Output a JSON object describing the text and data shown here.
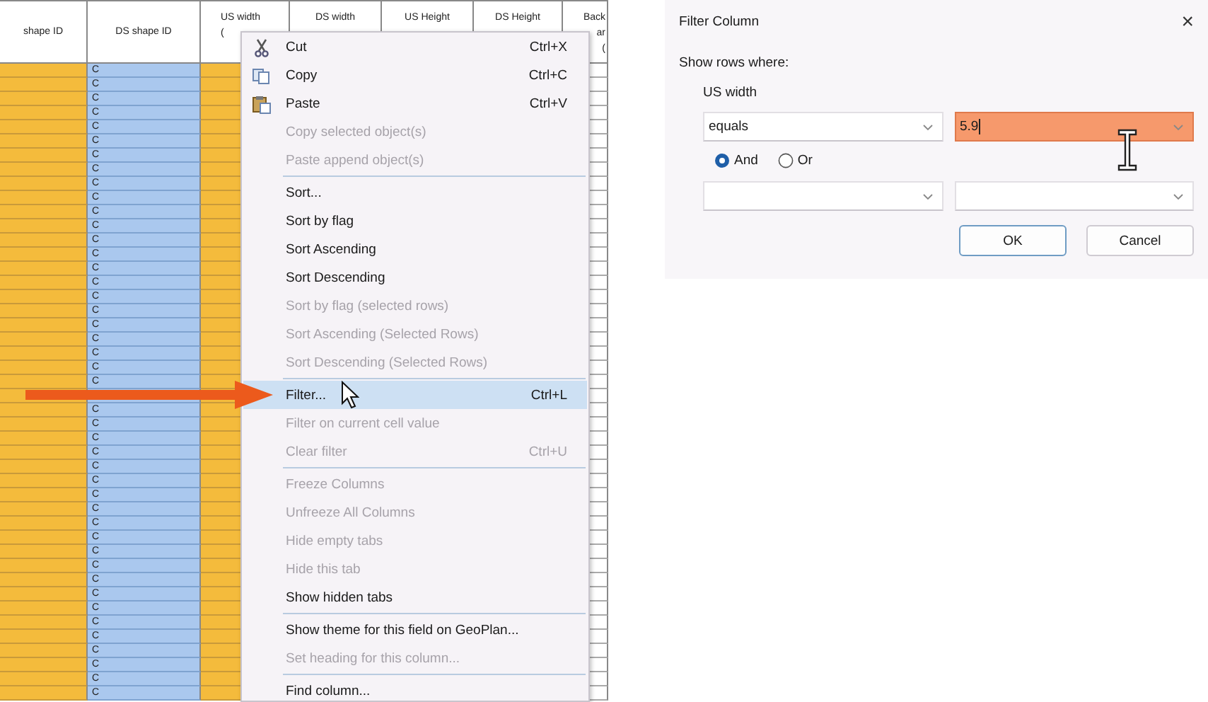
{
  "table": {
    "columns": [
      {
        "lines": [
          "shape ID"
        ],
        "kind": "key"
      },
      {
        "lines": [
          "DS shape ID"
        ],
        "kind": "link"
      },
      {
        "lines": [
          "US width",
          "("
        ],
        "kind": "key"
      },
      {
        "lines": [
          "DS width"
        ],
        "kind": "plain"
      },
      {
        "lines": [
          "US Height"
        ],
        "kind": "plain"
      },
      {
        "lines": [
          "DS Height"
        ],
        "kind": "plain"
      },
      {
        "lines": [
          "Back",
          "ar",
          "("
        ],
        "kind": "plain"
      }
    ],
    "rows": [
      {
        "ds_shape_id": "C"
      },
      {
        "ds_shape_id": "C"
      },
      {
        "ds_shape_id": "C"
      },
      {
        "ds_shape_id": "C"
      },
      {
        "ds_shape_id": "C"
      },
      {
        "ds_shape_id": "C"
      },
      {
        "ds_shape_id": "C"
      },
      {
        "ds_shape_id": "C"
      },
      {
        "ds_shape_id": "C"
      },
      {
        "ds_shape_id": "C"
      },
      {
        "ds_shape_id": "C"
      },
      {
        "ds_shape_id": "C"
      },
      {
        "ds_shape_id": "C"
      },
      {
        "ds_shape_id": "C"
      },
      {
        "ds_shape_id": "C"
      },
      {
        "ds_shape_id": "C"
      },
      {
        "ds_shape_id": "C"
      },
      {
        "ds_shape_id": "C"
      },
      {
        "ds_shape_id": "C"
      },
      {
        "ds_shape_id": "C"
      },
      {
        "ds_shape_id": "C"
      },
      {
        "ds_shape_id": "C"
      },
      {
        "ds_shape_id": "C"
      },
      {},
      {
        "ds_shape_id": "C"
      },
      {
        "ds_shape_id": "C"
      },
      {
        "ds_shape_id": "C"
      },
      {
        "ds_shape_id": "C"
      },
      {
        "ds_shape_id": "C"
      },
      {
        "ds_shape_id": "C"
      },
      {
        "ds_shape_id": "C"
      },
      {
        "ds_shape_id": "C"
      },
      {
        "ds_shape_id": "C"
      },
      {
        "ds_shape_id": "C"
      },
      {
        "ds_shape_id": "C"
      },
      {
        "ds_shape_id": "C"
      },
      {
        "ds_shape_id": "C"
      },
      {
        "ds_shape_id": "C"
      },
      {
        "ds_shape_id": "C"
      },
      {
        "ds_shape_id": "C"
      },
      {
        "ds_shape_id": "C"
      },
      {
        "ds_shape_id": "C"
      },
      {
        "ds_shape_id": "C"
      },
      {
        "ds_shape_id": "C"
      },
      {
        "ds_shape_id": "C"
      }
    ]
  },
  "menu": {
    "items": [
      {
        "label": "Cut",
        "shortcut": "Ctrl+X",
        "kind": "cut",
        "disabled": false,
        "selected": false,
        "separator_after": false
      },
      {
        "label": "Copy",
        "shortcut": "Ctrl+C",
        "kind": "copy",
        "disabled": false,
        "selected": false,
        "separator_after": false
      },
      {
        "label": "Paste",
        "shortcut": "Ctrl+V",
        "kind": "paste",
        "disabled": false,
        "selected": false,
        "separator_after": false
      },
      {
        "label": "Copy selected object(s)",
        "kind": "plain",
        "disabled": true,
        "selected": false,
        "separator_after": false
      },
      {
        "label": "Paste append object(s)",
        "kind": "plain",
        "disabled": true,
        "selected": false,
        "separator_after": true
      },
      {
        "label": "Sort...",
        "kind": "plain",
        "disabled": false,
        "selected": false,
        "separator_after": false
      },
      {
        "label": "Sort by flag",
        "kind": "plain",
        "disabled": false,
        "selected": false,
        "separator_after": false
      },
      {
        "label": "Sort Ascending",
        "kind": "plain",
        "disabled": false,
        "selected": false,
        "separator_after": false
      },
      {
        "label": "Sort Descending",
        "kind": "plain",
        "disabled": false,
        "selected": false,
        "separator_after": false
      },
      {
        "label": "Sort by flag (selected rows)",
        "kind": "plain",
        "disabled": true,
        "selected": false,
        "separator_after": false
      },
      {
        "label": "Sort Ascending (Selected Rows)",
        "kind": "plain",
        "disabled": true,
        "selected": false,
        "separator_after": false
      },
      {
        "label": "Sort Descending (Selected Rows)",
        "kind": "plain",
        "disabled": true,
        "selected": false,
        "separator_after": true
      },
      {
        "label": "Filter...",
        "shortcut": "Ctrl+L",
        "kind": "plain",
        "disabled": false,
        "selected": true,
        "separator_after": false
      },
      {
        "label": "Filter on current cell value",
        "kind": "plain",
        "disabled": true,
        "selected": false,
        "separator_after": false
      },
      {
        "label": "Clear filter",
        "shortcut": "Ctrl+U",
        "kind": "plain",
        "disabled": true,
        "selected": false,
        "separator_after": true
      },
      {
        "label": "Freeze Columns",
        "kind": "plain",
        "disabled": true,
        "selected": false,
        "separator_after": false
      },
      {
        "label": "Unfreeze All Columns",
        "kind": "plain",
        "disabled": true,
        "selected": false,
        "separator_after": false
      },
      {
        "label": "Hide empty tabs",
        "kind": "plain",
        "disabled": true,
        "selected": false,
        "separator_after": false
      },
      {
        "label": "Hide this tab",
        "kind": "plain",
        "disabled": true,
        "selected": false,
        "separator_after": false
      },
      {
        "label": "Show hidden tabs",
        "kind": "plain",
        "disabled": false,
        "selected": false,
        "separator_after": true
      },
      {
        "label": "Show theme for this field on GeoPlan...",
        "kind": "plain",
        "disabled": false,
        "selected": false,
        "separator_after": false
      },
      {
        "label": "Set heading for this column...",
        "kind": "plain",
        "disabled": true,
        "selected": false,
        "separator_after": true
      },
      {
        "label": "Find column...",
        "kind": "plain",
        "disabled": false,
        "selected": false,
        "separator_after": false
      }
    ]
  },
  "dialog": {
    "title": "Filter Column",
    "close": "×",
    "prompt": "Show rows where:",
    "field": "US width",
    "conditions": [
      {
        "operator": "equals",
        "value": "5.9",
        "highlighted": true
      },
      {
        "highlighted": false
      }
    ],
    "joins": [
      {
        "label": "And",
        "selected": true
      },
      {
        "label": "Or",
        "selected": false
      }
    ],
    "buttons": [
      {
        "label": "OK",
        "default": true
      },
      {
        "label": "Cancel",
        "default": false
      }
    ]
  }
}
